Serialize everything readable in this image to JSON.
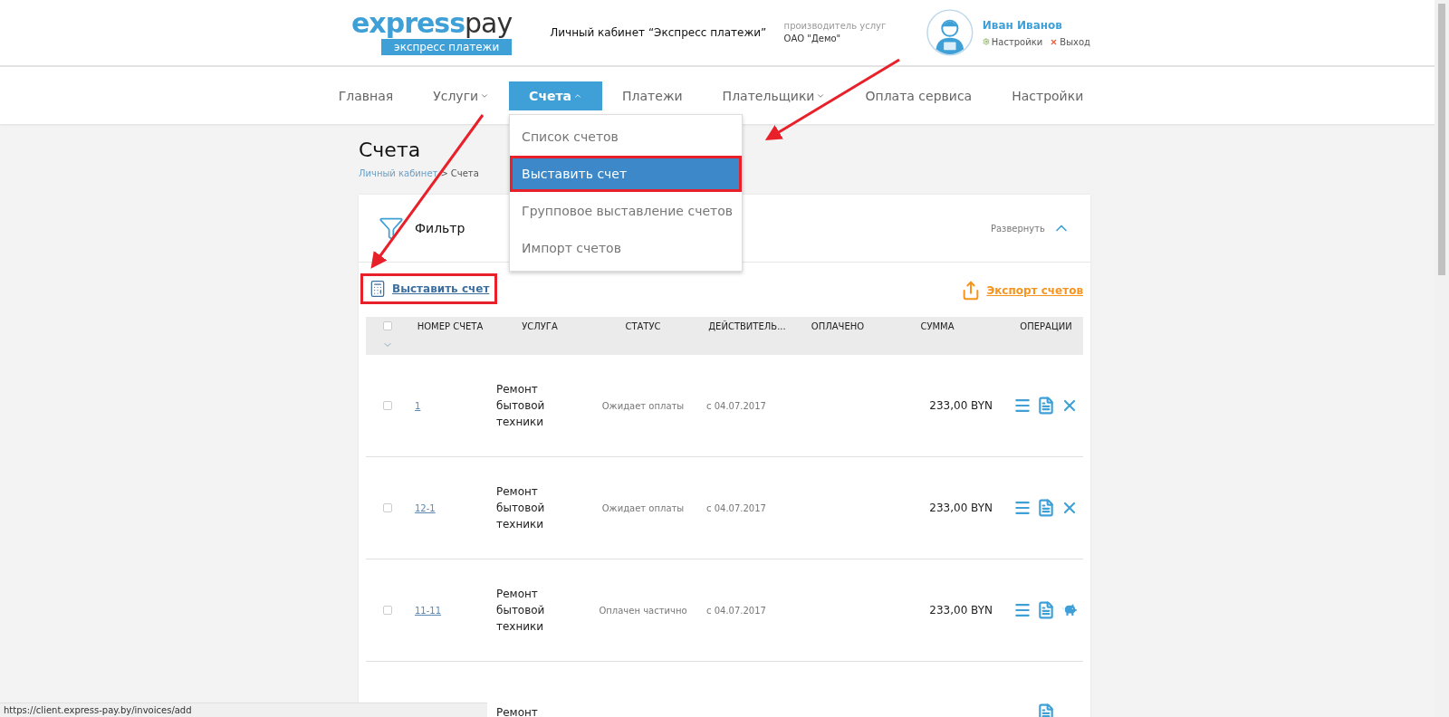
{
  "header": {
    "logo": {
      "part_1": "express",
      "part_2": "pay",
      "tagline": "экспресс платежи"
    },
    "title": "Личный кабинет “Экспресс платежи”",
    "provider": {
      "label": "производитель услуг",
      "name": "ОАО \"Демо\""
    },
    "user": {
      "name": "Иван Иванов",
      "settings": "Настройки",
      "logout": "Выход"
    }
  },
  "nav": [
    {
      "label": "Главная",
      "selected": false,
      "dropdown": false
    },
    {
      "label": "Услуги",
      "selected": false,
      "dropdown": true
    },
    {
      "label": "Счета",
      "selected": true,
      "dropdown": true
    },
    {
      "label": "Платежи",
      "selected": false,
      "dropdown": false
    },
    {
      "label": "Плательщики",
      "selected": false,
      "dropdown": true
    },
    {
      "label": "Оплата сервиса",
      "selected": false,
      "dropdown": false
    },
    {
      "label": "Настройки",
      "selected": false,
      "dropdown": false
    }
  ],
  "menu": [
    {
      "label": "Список счетов",
      "selected": false,
      "highlighted": false
    },
    {
      "label": "Выставить счет",
      "selected": true,
      "highlighted": true
    },
    {
      "label": "Групповое выставление счетов",
      "selected": false,
      "highlighted": false
    },
    {
      "label": "Импорт счетов",
      "selected": false,
      "highlighted": false
    }
  ],
  "page_title": "Счета",
  "breadcrumb": {
    "link": "Личный кабинет",
    "separator": ">",
    "current": "Счета"
  },
  "filter": {
    "title": "Фильтр",
    "toggle": "Развернуть",
    "expanded": true
  },
  "add_invoice": {
    "label": "Выставить счет",
    "highlighted": true
  },
  "export": {
    "label": "Экспорт счетов"
  },
  "table": {
    "all_checked": false,
    "columns": [
      "НОМЕР СЧЕТА",
      "УСЛУГА",
      "СТАТУС",
      "ДЕЙСТВИТЕЛЬ...",
      "ОПЛАЧЕНО",
      "СУММА",
      "ОПЕРАЦИИ"
    ],
    "rows": [
      {
        "checked": false,
        "number": "1",
        "service": "Ремонт бытовой техники",
        "status": "Ожидает оплаты",
        "valid": "с 04.07.2017",
        "amount": "233,00 BYN",
        "operations": [
          {
            "kind": "list"
          },
          {
            "kind": "copy"
          },
          {
            "kind": "cancel"
          }
        ]
      },
      {
        "checked": false,
        "number": "12-1",
        "service": "Ремонт бытовой техники",
        "status": "Ожидает оплаты",
        "valid": "с 04.07.2017",
        "amount": "233,00 BYN",
        "operations": [
          {
            "kind": "list"
          },
          {
            "kind": "copy"
          },
          {
            "kind": "cancel"
          }
        ]
      },
      {
        "checked": false,
        "number": "11-11",
        "service": "Ремонт бытовой техники",
        "status": "Оплачен частично",
        "valid": "с 04.07.2017",
        "amount": "233,00 BYN",
        "operations": [
          {
            "kind": "list"
          },
          {
            "kind": "copy"
          },
          {
            "kind": "piggy"
          }
        ]
      },
      {
        "service": "Ремонт",
        "operations": [
          {
            "kind": "copy"
          }
        ]
      }
    ]
  },
  "status_bar": "https://client.express-pay.by/invoices/add"
}
